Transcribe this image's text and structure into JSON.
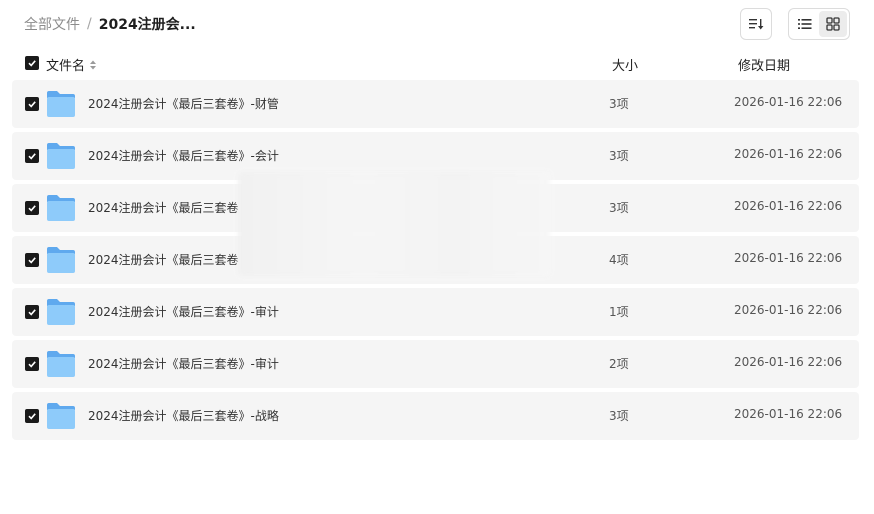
{
  "breadcrumb": {
    "root": "全部文件",
    "separator": "/",
    "current": "2024注册会..."
  },
  "toolbar": {
    "sort_icon": "sort-list-icon",
    "list_view_icon": "list-view-icon",
    "grid_view_icon": "grid-view-icon",
    "active_view": "list"
  },
  "table": {
    "headers": {
      "name": "文件名",
      "size": "大小",
      "date": "修改日期"
    },
    "rows": [
      {
        "name": "2024注册会计《最后三套卷》-财管",
        "size": "3项",
        "date": "2026-01-16 22:06"
      },
      {
        "name": "2024注册会计《最后三套卷》-会计",
        "size": "3项",
        "date": "2026-01-16 22:06"
      },
      {
        "name": "2024注册会计《最后三套卷",
        "size": "3项",
        "date": "2026-01-16 22:06"
      },
      {
        "name": "2024注册会计《最后三套卷",
        "size": "4项",
        "date": "2026-01-16 22:06"
      },
      {
        "name": "2024注册会计《最后三套卷》-审计",
        "size": "1项",
        "date": "2026-01-16 22:06"
      },
      {
        "name": "2024注册会计《最后三套卷》-审计",
        "size": "2项",
        "date": "2026-01-16 22:06"
      },
      {
        "name": "2024注册会计《最后三套卷》-战略",
        "size": "3项",
        "date": "2026-01-16 22:06"
      }
    ]
  },
  "colors": {
    "row_bg": "#f5f5f5",
    "checkbox": "#1a1a1a",
    "folder": "#7cc0f7"
  }
}
